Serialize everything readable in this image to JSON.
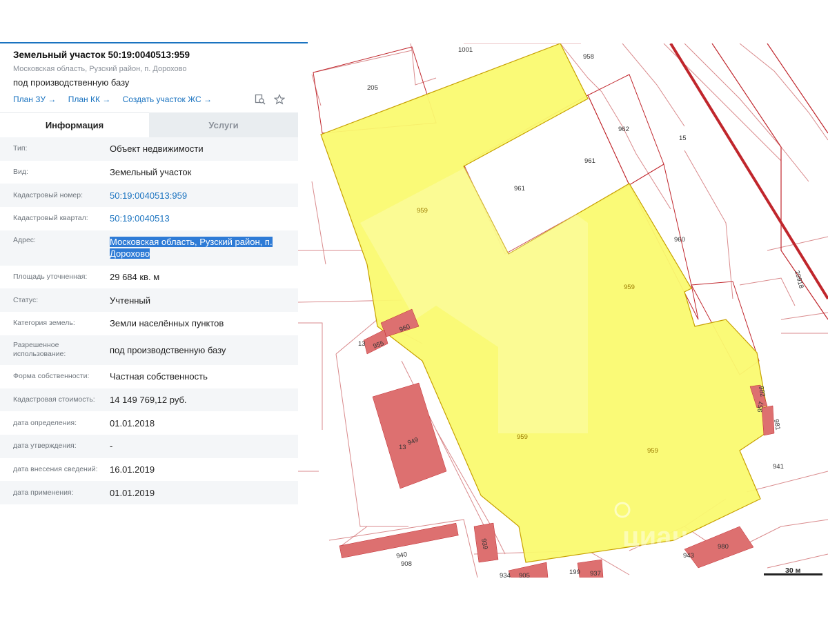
{
  "header": {
    "title": "Земельный участок 50:19:0040513:959",
    "address": "Московская область, Рузский район, п. Дорохово",
    "purpose": "под производственную базу",
    "links": [
      "План ЗУ →",
      "План КК →",
      "Создать участок ЖС →"
    ]
  },
  "icons": {
    "search": "search-doc-icon",
    "star": "star-icon"
  },
  "tabs": [
    {
      "label": "Информация",
      "active": true
    },
    {
      "label": "Услуги",
      "active": false
    }
  ],
  "info": [
    {
      "label": "Тип:",
      "value": "Объект недвижимости"
    },
    {
      "label": "Вид:",
      "value": "Земельный участок"
    },
    {
      "label": "Кадастровый номер:",
      "value": "50:19:0040513:959"
    },
    {
      "label": "Кадастровый квартал:",
      "value": "50:19:0040513"
    },
    {
      "label": "Адрес:",
      "value": "Московская область, Рузский район, п. Дорохово"
    },
    {
      "label": "Площадь уточненная:",
      "value": "29 684 кв. м"
    },
    {
      "label": "Статус:",
      "value": "Учтенный"
    },
    {
      "label": "Категория земель:",
      "value": "Земли населённых пунктов"
    },
    {
      "label": "Разрешенное использование:",
      "value": "под производственную базу"
    },
    {
      "label": "Форма собственности:",
      "value": "Частная собственность"
    },
    {
      "label": "Кадастровая стоимость:",
      "value": "14 149 769,12 руб."
    },
    {
      "label": "дата определения:",
      "value": "01.01.2018"
    },
    {
      "label": "дата утверждения:",
      "value": "-"
    },
    {
      "label": "дата внесения сведений:",
      "value": "16.01.2019"
    },
    {
      "label": "дата применения:",
      "value": "01.01.2019"
    }
  ],
  "map": {
    "parcel_labels": [
      "1001",
      "958",
      "205",
      "962",
      "15",
      "961",
      "961",
      "959",
      "960",
      "959",
      "29918",
      "13",
      "955",
      "960",
      "982",
      "957",
      "981",
      "959",
      "959",
      "941",
      "13",
      "949",
      "940",
      "908",
      "939",
      "943",
      "980",
      "199",
      "937",
      "905",
      "934"
    ],
    "scale": "30 м",
    "watermark": "циан",
    "colors": {
      "parcel_fill": "#fafa70",
      "parcel_stroke": "#c7a000",
      "boundary": "#c0262c",
      "building": "#dd7070",
      "highlight": "#2e7bd6",
      "link": "#1a73c0"
    }
  }
}
